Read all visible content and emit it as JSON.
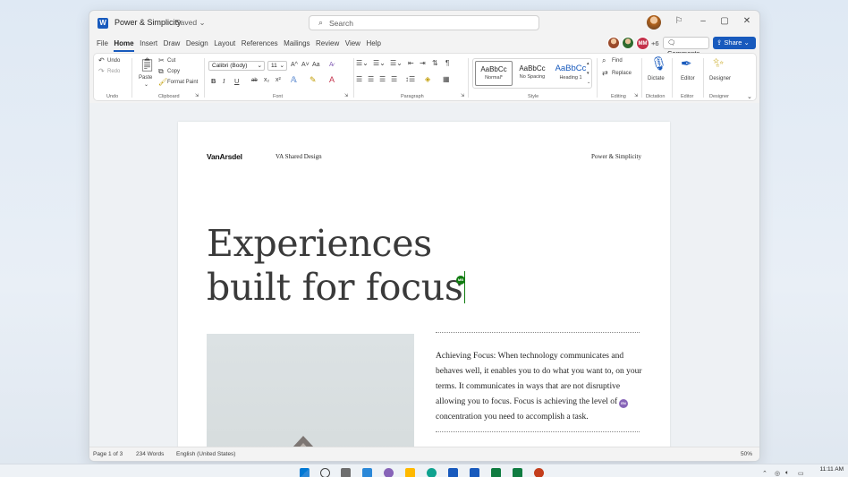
{
  "window": {
    "title": "Power & Simplicity",
    "saved_status": "Saved ⌄",
    "search_placeholder": "Search",
    "minimize": "–",
    "maximize": "▢",
    "close": "✕"
  },
  "menu": [
    "File",
    "Home",
    "Insert",
    "Draw",
    "Design",
    "Layout",
    "References",
    "Mailings",
    "Review",
    "View",
    "Help"
  ],
  "menu_active": "Home",
  "collab": {
    "initials": "MM",
    "more": "+6"
  },
  "comments_label": "Comments",
  "share_label": "Share ⌄",
  "ribbon": {
    "undo": "Undo",
    "redo": "Redo",
    "undo_group": "Undo",
    "paste": "Paste",
    "cut": "Cut",
    "copy": "Copy",
    "format_paint": "Format Paint",
    "clipboard_group": "Clipboard",
    "font_name": "Calibri (Body)",
    "font_size": "11",
    "font_group": "Font",
    "bold": "B",
    "italic": "I",
    "underline": "U",
    "strike": "ab",
    "subscript": "x₂",
    "superscript": "x²",
    "grow": "A^",
    "shrink": "A˅",
    "case": "Aa",
    "clear": "A̷",
    "paragraph_group": "Paragraph",
    "styles": [
      {
        "sample": "AaBbCc",
        "name": "Normal*"
      },
      {
        "sample": "AaBbCc",
        "name": "No Spacing"
      },
      {
        "sample": "AaBbCc",
        "name": "Heading 1"
      }
    ],
    "style_group": "Style",
    "find": "Find",
    "replace": "Replace",
    "editing_group": "Editing",
    "dictate": "Dictate",
    "dictation_group": "Dictation",
    "editor": "Editor",
    "editor_group": "Editor",
    "designer": "Designer",
    "designer_group": "Designer"
  },
  "document": {
    "logo": "VanArsdel",
    "header_mid": "VA Shared Design",
    "header_right": "Power & Simplicity",
    "headline_line1": "Experiences",
    "headline_line2": "built for focus",
    "cursor_tag": "MB",
    "paragraph": "Achieving Focus: When technology communicates and behaves well, it enables you to do what you want to, on your terms. It communicates in ways that are not disruptive allowing you to focus. Focus is achieving the level of concentration you need to accomplish a task.",
    "para_tag": "EN"
  },
  "status": {
    "page": "Page 1 of 3",
    "words": "234 Words",
    "language": "English (United States)",
    "zoom": "50%"
  },
  "taskbar": {
    "time": "11:11 AM"
  },
  "colors": {
    "accent": "#185abd",
    "cursor_green": "#107c10",
    "tag_purple": "#8764b8",
    "mm_red": "#c4314b"
  }
}
